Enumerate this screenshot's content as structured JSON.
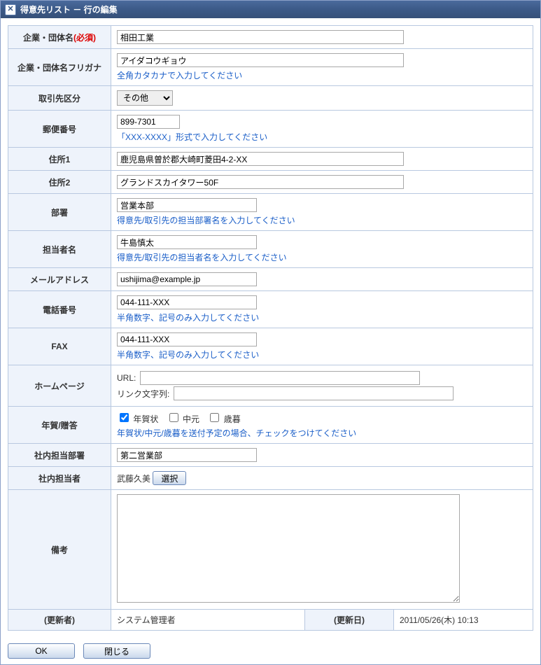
{
  "window": {
    "title": "得意先リスト － 行の編集"
  },
  "labels": {
    "company": "企業・団体名",
    "required": "(必須)",
    "company_kana": "企業・団体名フリガナ",
    "category": "取引先区分",
    "postal": "郵便番号",
    "addr1": "住所1",
    "addr2": "住所2",
    "dept": "部署",
    "contact": "担当者名",
    "email": "メールアドレス",
    "tel": "電話番号",
    "fax": "FAX",
    "homepage": "ホームページ",
    "gifts": "年賀/贈答",
    "internal_dept": "社内担当部署",
    "internal_person": "社内担当者",
    "notes": "備考",
    "updater": "(更新者)",
    "updated": "(更新日)",
    "url": "URL:",
    "linktext": "リンク文字列:",
    "select_btn": "選択",
    "gift_nenga": "年賀状",
    "gift_chugen": "中元",
    "gift_seibo": "歳暮"
  },
  "hints": {
    "kana": "全角カタカナで入力してください",
    "postal": "「XXX-XXXX」形式で入力してください",
    "dept": "得意先/取引先の担当部署名を入力してください",
    "contact": "得意先/取引先の担当者名を入力してください",
    "tel": "半角数字、記号のみ入力してください",
    "fax": "半角数字、記号のみ入力してください",
    "gifts": "年賀状/中元/歳暮を送付予定の場合、チェックをつけてください"
  },
  "values": {
    "company": "相田工業",
    "company_kana": "アイダコウギョウ",
    "category_selected": "その他",
    "postal": "899-7301",
    "addr1": "鹿児島県曽於郡大崎町菱田4-2-XX",
    "addr2": "グランドスカイタワー50F",
    "dept": "営業本部",
    "contact": "牛島慎太",
    "email": "ushijima@example.jp",
    "tel": "044-111-XXX",
    "fax": "044-111-XXX",
    "hp_url": "",
    "hp_linktext": "",
    "gift_nenga_checked": true,
    "gift_chugen_checked": false,
    "gift_seibo_checked": false,
    "internal_dept": "第二営業部",
    "internal_person": "武藤久美",
    "notes": "",
    "updater": "システム管理者",
    "updated": "2011/05/26(木) 10:13"
  },
  "buttons": {
    "ok": "OK",
    "close": "閉じる"
  }
}
